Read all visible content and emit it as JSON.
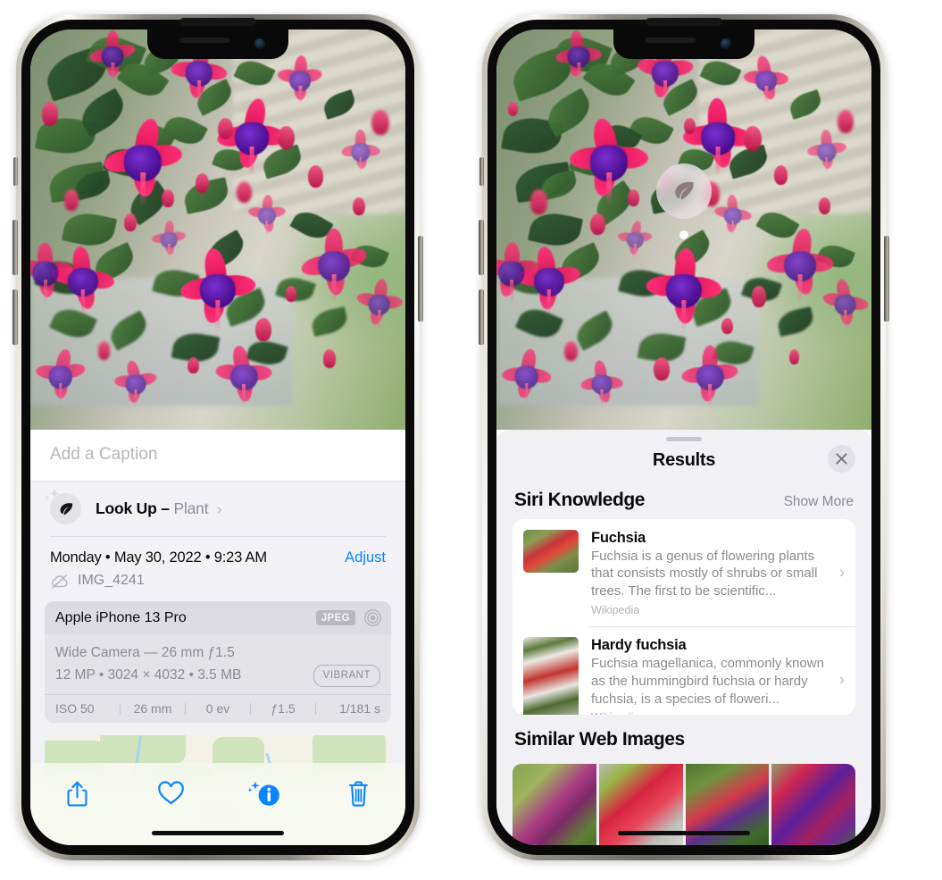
{
  "left_phone": {
    "caption_placeholder": "Add a Caption",
    "lookup": {
      "label": "Look Up –",
      "subject": "Plant",
      "chevron": "›",
      "icon": "leaf-icon"
    },
    "metadata": {
      "date": "Monday • May 30, 2022 • 9:23 AM",
      "adjust_label": "Adjust",
      "filename": "IMG_4241",
      "cloud_icon": "cloud-slash-icon"
    },
    "camera_card": {
      "device": "Apple iPhone 13 Pro",
      "format_badge": "JPEG",
      "hdr_icon": "aperture-icon",
      "lens_line": "Wide Camera — 26 mm ƒ1.5",
      "size_line": "12 MP • 3024 × 4032 • 3.5 MB",
      "style_badge": "VIBRANT",
      "exif": [
        "ISO 50",
        "26 mm",
        "0 ev",
        "ƒ1.5",
        "1/181 s"
      ]
    },
    "toolbar": [
      {
        "name": "share-button",
        "glyph": "share"
      },
      {
        "name": "favorite-button",
        "glyph": "heart"
      },
      {
        "name": "info-button",
        "glyph": "info"
      },
      {
        "name": "delete-button",
        "glyph": "trash"
      }
    ]
  },
  "right_phone": {
    "badge_icon": "leaf-icon",
    "sheet": {
      "title": "Results",
      "close_icon": "close-icon"
    },
    "siri_knowledge": {
      "title": "Siri Knowledge",
      "show_more": "Show More",
      "items": [
        {
          "title": "Fuchsia",
          "description": "Fuchsia is a genus of flowering plants that consists mostly of shrubs or small trees. The first to be scientific...",
          "source": "Wikipedia"
        },
        {
          "title": "Hardy fuchsia",
          "description": "Fuchsia magellanica, commonly known as the hummingbird fuchsia or hardy fuchsia, is a species of floweri...",
          "source": "Wikipedia"
        }
      ]
    },
    "similar_web_images": {
      "title": "Similar Web Images",
      "count": 4
    }
  },
  "colors": {
    "accent_blue": "#0a84ff",
    "sheet_bg": "#f1f0f5",
    "card_bg": "#ffffff",
    "secondary_text": "#8c8b91",
    "primary_text": "#0b0b0d"
  }
}
